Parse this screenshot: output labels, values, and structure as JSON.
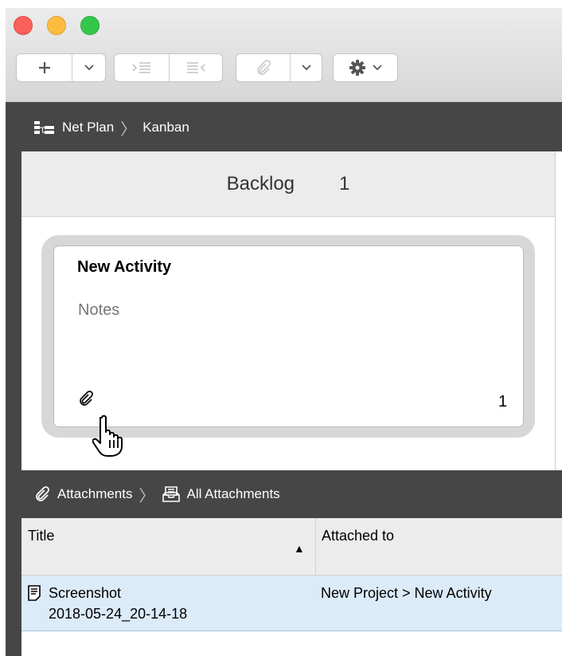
{
  "toolbar": {
    "add_icon": "plus-icon",
    "indent_icon": "indent-icon",
    "outdent_icon": "outdent-icon",
    "attach_icon": "paperclip-icon",
    "settings_icon": "gear-icon"
  },
  "breadcrumb": {
    "root": "Net Plan",
    "current": "Kanban"
  },
  "kanban": {
    "column": {
      "name": "Backlog",
      "count": "1"
    },
    "card": {
      "title": "New Activity",
      "notes": "Notes",
      "attachment_count": "1"
    }
  },
  "attachments_bar": {
    "root": "Attachments",
    "current": "All Attachments"
  },
  "table": {
    "columns": [
      "Title",
      "Attached to"
    ],
    "rows": [
      {
        "title_line1": "Screenshot",
        "title_line2": "2018-05-24_20-14-18",
        "attached_to": "New Project > New Activity"
      }
    ]
  }
}
